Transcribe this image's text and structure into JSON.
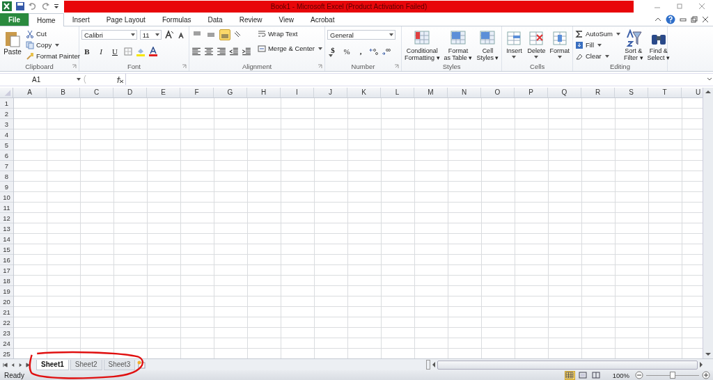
{
  "title_bar": {
    "title": "Book1  -  Microsoft Excel (Product Activation Failed)"
  },
  "ribbon_tabs": [
    {
      "label": "File",
      "kind": "file",
      "selected": false
    },
    {
      "label": "Home",
      "kind": "tab",
      "selected": true
    },
    {
      "label": "Insert",
      "kind": "tab",
      "selected": false
    },
    {
      "label": "Page Layout",
      "kind": "tab",
      "selected": false
    },
    {
      "label": "Formulas",
      "kind": "tab",
      "selected": false
    },
    {
      "label": "Data",
      "kind": "tab",
      "selected": false
    },
    {
      "label": "Review",
      "kind": "tab",
      "selected": false
    },
    {
      "label": "View",
      "kind": "tab",
      "selected": false
    },
    {
      "label": "Acrobat",
      "kind": "tab",
      "selected": false
    }
  ],
  "clipboard": {
    "label": "Clipboard",
    "paste": "Paste",
    "cut": "Cut",
    "copy": "Copy",
    "format_painter": "Format Painter"
  },
  "font": {
    "label": "Font",
    "font_name": "Calibri",
    "font_size": "11",
    "bold": "B",
    "italic": "I",
    "underline": "U"
  },
  "alignment": {
    "label": "Alignment",
    "vertical": [
      {
        "selected": false
      },
      {
        "selected": false
      },
      {
        "selected": true
      }
    ],
    "wrap_text": "Wrap Text",
    "merge_center": "Merge & Center"
  },
  "number": {
    "label": "Number",
    "format": "General",
    "currency": "$",
    "percent": "%",
    "comma": ","
  },
  "styles": {
    "label": "Styles",
    "buttons": [
      {
        "lines": [
          "Conditional",
          "Formatting ▾"
        ],
        "kind": "conditional"
      },
      {
        "lines": [
          "Format",
          "as Table ▾"
        ],
        "kind": "table"
      },
      {
        "lines": [
          "Cell",
          "Styles ▾"
        ],
        "kind": "cellstyles"
      }
    ]
  },
  "cells": {
    "label": "Cells",
    "buttons": [
      {
        "label": "Insert",
        "kind": "insert"
      },
      {
        "label": "Delete",
        "kind": "delete"
      },
      {
        "label": "Format",
        "kind": "format"
      }
    ]
  },
  "editing": {
    "label": "Editing",
    "autosum": "AutoSum",
    "fill": "Fill",
    "clear": "Clear",
    "sort": [
      "Sort &",
      "Filter ▾"
    ],
    "find": [
      "Find &",
      "Select ▾"
    ]
  },
  "formula_bar": {
    "name_box": "A1"
  },
  "columns": [
    "A",
    "B",
    "C",
    "D",
    "E",
    "F",
    "G",
    "H",
    "I",
    "J",
    "K",
    "L",
    "M",
    "N",
    "O",
    "P",
    "Q",
    "R",
    "S",
    "T",
    "U"
  ],
  "rows": [
    "1",
    "2",
    "3",
    "4",
    "5",
    "6",
    "7",
    "8",
    "9",
    "10",
    "11",
    "12",
    "13",
    "14",
    "15",
    "16",
    "17",
    "18",
    "19",
    "20",
    "21",
    "22",
    "23",
    "24",
    "25"
  ],
  "sheets": [
    {
      "label": "Sheet1",
      "selected": true
    },
    {
      "label": "Sheet2",
      "selected": false
    },
    {
      "label": "Sheet3",
      "selected": false
    }
  ],
  "status_bar": {
    "status": "Ready",
    "views": [
      {
        "selected": true
      },
      {
        "selected": false
      },
      {
        "selected": false
      }
    ],
    "zoom": "100%",
    "zoom_level": {
      "level": 0.5
    }
  }
}
